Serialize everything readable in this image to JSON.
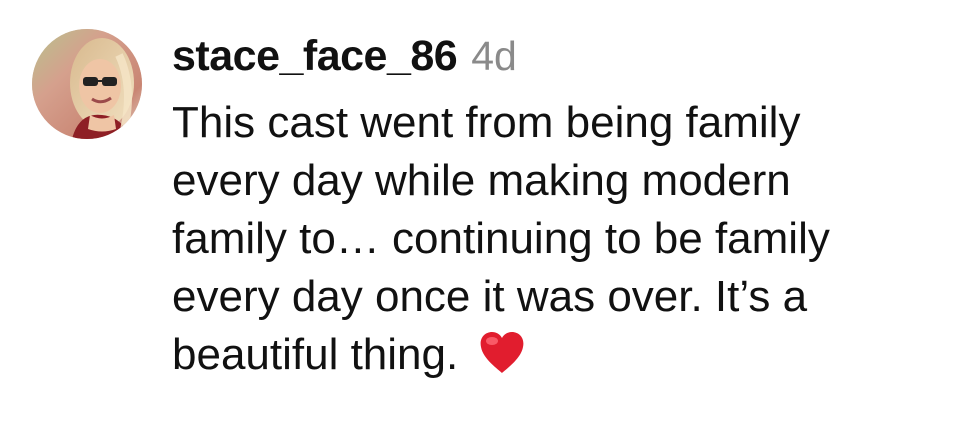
{
  "comment": {
    "username": "stace_face_86",
    "timestamp": "4d",
    "text_lines": [
      "This cast went from being family",
      "every day while making modern",
      "family to… continuing to be family",
      "every day once it was over. It’s a",
      "beautiful thing."
    ],
    "emoji": "red-heart-icon"
  }
}
